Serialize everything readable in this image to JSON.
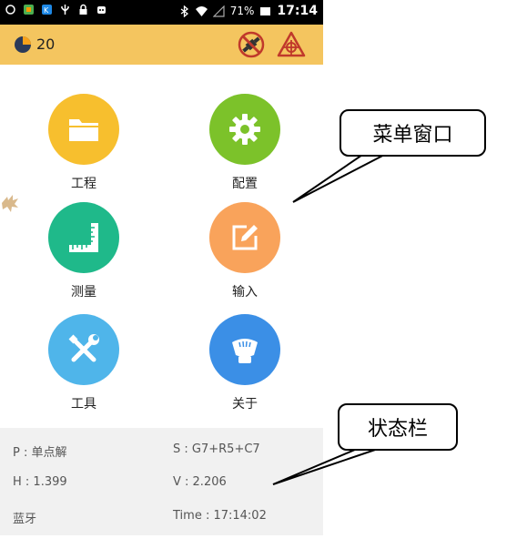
{
  "status_bar": {
    "battery": "71%",
    "time": "17:14",
    "left_icons": [
      "sync-icon",
      "app-icon",
      "app-icon",
      "usb-icon",
      "lock-icon",
      "robot-icon"
    ],
    "right_icons": [
      "bluetooth-icon",
      "wifi-icon",
      "signal-icon",
      "battery-icon"
    ]
  },
  "app_bar": {
    "satellite_count": "20",
    "icons": [
      "satellite-off-icon",
      "target-warning-icon"
    ],
    "color": "#f4c55f"
  },
  "menu": {
    "items": [
      {
        "label": "工程",
        "icon": "folder-icon",
        "color": "#f7bf2e"
      },
      {
        "label": "配置",
        "icon": "gear-icon",
        "color": "#7cc22a"
      },
      {
        "label": "测量",
        "icon": "ruler-icon",
        "color": "#1fb98a"
      },
      {
        "label": "输入",
        "icon": "edit-icon",
        "color": "#f9a35b"
      },
      {
        "label": "工具",
        "icon": "tools-icon",
        "color": "#4fb5ea"
      },
      {
        "label": "关于",
        "icon": "receiver-icon",
        "color": "#3b8fe6"
      }
    ]
  },
  "status_panel": {
    "p": "P : 单点解",
    "s": "S : G7+R5+C7",
    "h": "H : 1.399",
    "v": "V : 2.206",
    "conn": "蓝牙",
    "time": "Time :  17:14:02"
  },
  "callouts": {
    "menu": "菜单窗口",
    "status": "状态栏"
  }
}
